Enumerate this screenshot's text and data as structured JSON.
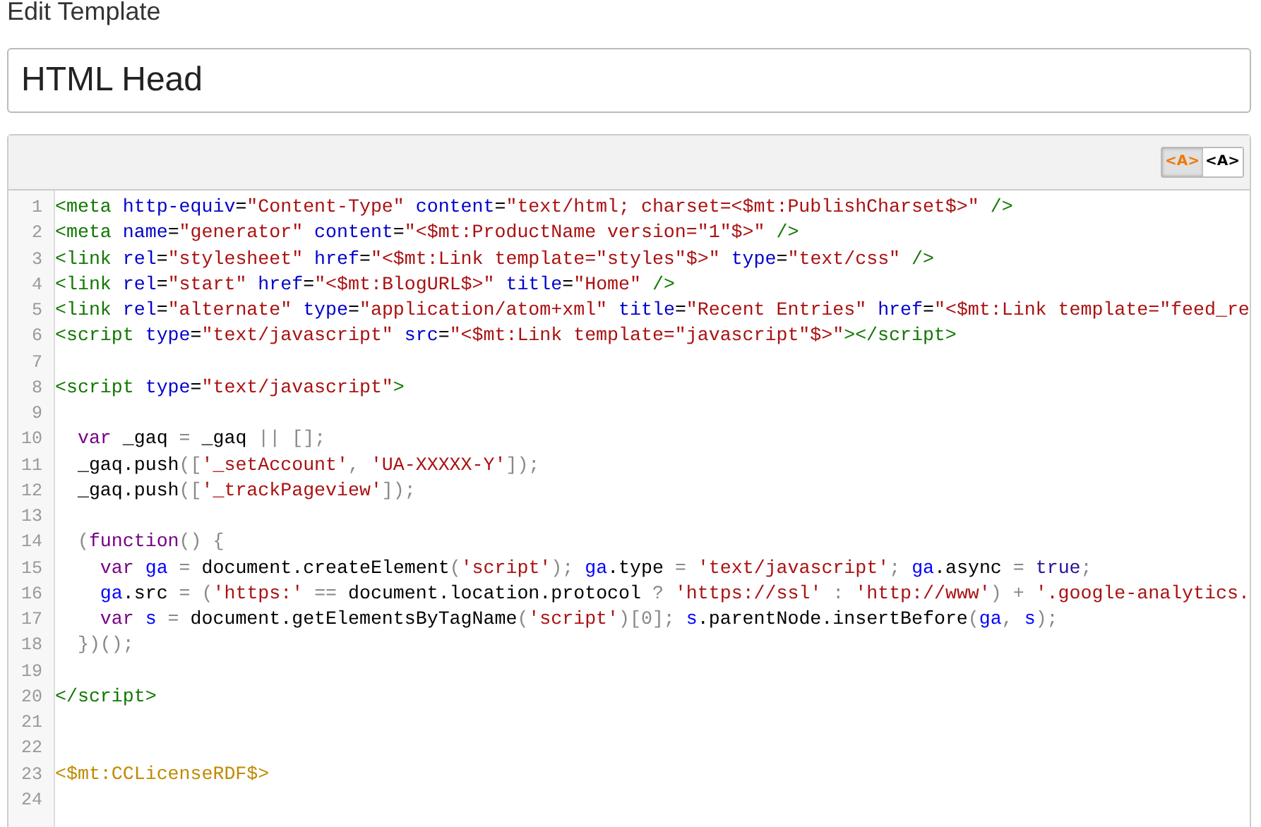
{
  "heading": "Edit Template",
  "template_name": {
    "value": "HTML Head"
  },
  "editor": {
    "toolbar": [
      {
        "label": "<A>",
        "selected": true
      },
      {
        "label": "<A>",
        "selected": false
      }
    ],
    "lines": [
      {
        "number": "1",
        "tokens": [
          {
            "kind": "tag",
            "text": "<meta"
          },
          {
            "kind": "attr",
            "text": " http-equiv"
          },
          {
            "kind": "plain",
            "text": "="
          },
          {
            "kind": "str",
            "text": "\"Content-Type\""
          },
          {
            "kind": "attr",
            "text": " content"
          },
          {
            "kind": "plain",
            "text": "="
          },
          {
            "kind": "str",
            "text": "\"text/html; charset=<$mt:PublishCharset$>\""
          },
          {
            "kind": "tag",
            "text": " />"
          }
        ]
      },
      {
        "number": "2",
        "tokens": [
          {
            "kind": "tag",
            "text": "<meta"
          },
          {
            "kind": "attr",
            "text": " name"
          },
          {
            "kind": "plain",
            "text": "="
          },
          {
            "kind": "str",
            "text": "\"generator\""
          },
          {
            "kind": "attr",
            "text": " content"
          },
          {
            "kind": "plain",
            "text": "="
          },
          {
            "kind": "str",
            "text": "\"<$mt:ProductName version=\"1\"$>\""
          },
          {
            "kind": "tag",
            "text": " />"
          }
        ]
      },
      {
        "number": "3",
        "tokens": [
          {
            "kind": "tag",
            "text": "<link"
          },
          {
            "kind": "attr",
            "text": " rel"
          },
          {
            "kind": "plain",
            "text": "="
          },
          {
            "kind": "str",
            "text": "\"stylesheet\""
          },
          {
            "kind": "attr",
            "text": " href"
          },
          {
            "kind": "plain",
            "text": "="
          },
          {
            "kind": "str",
            "text": "\"<$mt:Link template=\"styles\"$>\""
          },
          {
            "kind": "attr",
            "text": " type"
          },
          {
            "kind": "plain",
            "text": "="
          },
          {
            "kind": "str",
            "text": "\"text/css\""
          },
          {
            "kind": "tag",
            "text": " />"
          }
        ]
      },
      {
        "number": "4",
        "tokens": [
          {
            "kind": "tag",
            "text": "<link"
          },
          {
            "kind": "attr",
            "text": " rel"
          },
          {
            "kind": "plain",
            "text": "="
          },
          {
            "kind": "str",
            "text": "\"start\""
          },
          {
            "kind": "attr",
            "text": " href"
          },
          {
            "kind": "plain",
            "text": "="
          },
          {
            "kind": "str",
            "text": "\"<$mt:BlogURL$>\""
          },
          {
            "kind": "attr",
            "text": " title"
          },
          {
            "kind": "plain",
            "text": "="
          },
          {
            "kind": "str",
            "text": "\"Home\""
          },
          {
            "kind": "tag",
            "text": " />"
          }
        ]
      },
      {
        "number": "5",
        "tokens": [
          {
            "kind": "tag",
            "text": "<link"
          },
          {
            "kind": "attr",
            "text": " rel"
          },
          {
            "kind": "plain",
            "text": "="
          },
          {
            "kind": "str",
            "text": "\"alternate\""
          },
          {
            "kind": "attr",
            "text": " type"
          },
          {
            "kind": "plain",
            "text": "="
          },
          {
            "kind": "str",
            "text": "\"application/atom+xml\""
          },
          {
            "kind": "attr",
            "text": " title"
          },
          {
            "kind": "plain",
            "text": "="
          },
          {
            "kind": "str",
            "text": "\"Recent Entries\""
          },
          {
            "kind": "attr",
            "text": " href"
          },
          {
            "kind": "plain",
            "text": "="
          },
          {
            "kind": "str",
            "text": "\"<$mt:Link template=\"feed_re"
          }
        ]
      },
      {
        "number": "6",
        "tokens": [
          {
            "kind": "tag",
            "text": "<script"
          },
          {
            "kind": "attr",
            "text": " type"
          },
          {
            "kind": "plain",
            "text": "="
          },
          {
            "kind": "str",
            "text": "\"text/javascript\""
          },
          {
            "kind": "attr",
            "text": " src"
          },
          {
            "kind": "plain",
            "text": "="
          },
          {
            "kind": "str",
            "text": "\"<$mt:Link template=\"javascript\"$>\""
          },
          {
            "kind": "tag",
            "text": "></script>"
          }
        ]
      },
      {
        "number": "7"
      },
      {
        "number": "8",
        "tokens": [
          {
            "kind": "tag",
            "text": "<script"
          },
          {
            "kind": "attr",
            "text": " type"
          },
          {
            "kind": "plain",
            "text": "="
          },
          {
            "kind": "str",
            "text": "\"text/javascript\""
          },
          {
            "kind": "tag",
            "text": ">"
          }
        ]
      },
      {
        "number": "9"
      },
      {
        "number": "10",
        "tokens": [
          {
            "kind": "kw",
            "text": "  var"
          },
          {
            "kind": "plain",
            "text": " _gaq "
          },
          {
            "kind": "op",
            "text": "="
          },
          {
            "kind": "plain",
            "text": " _gaq "
          },
          {
            "kind": "op",
            "text": "|| [];"
          }
        ]
      },
      {
        "number": "11",
        "tokens": [
          {
            "kind": "plain",
            "text": "  _gaq.push"
          },
          {
            "kind": "op",
            "text": "(["
          },
          {
            "kind": "str",
            "text": "'_setAccount'"
          },
          {
            "kind": "op",
            "text": ", "
          },
          {
            "kind": "str",
            "text": "'UA-XXXXX-Y'"
          },
          {
            "kind": "op",
            "text": "]);"
          }
        ]
      },
      {
        "number": "12",
        "tokens": [
          {
            "kind": "plain",
            "text": "  _gaq.push"
          },
          {
            "kind": "op",
            "text": "(["
          },
          {
            "kind": "str",
            "text": "'_trackPageview'"
          },
          {
            "kind": "op",
            "text": "]);"
          }
        ]
      },
      {
        "number": "13"
      },
      {
        "number": "14",
        "tokens": [
          {
            "kind": "op",
            "text": "  ("
          },
          {
            "kind": "kw",
            "text": "function"
          },
          {
            "kind": "op",
            "text": "() {"
          }
        ]
      },
      {
        "number": "15",
        "tokens": [
          {
            "kind": "kw",
            "text": "    var"
          },
          {
            "kind": "def",
            "text": " ga"
          },
          {
            "kind": "op",
            "text": " = "
          },
          {
            "kind": "plain",
            "text": "document.createElement"
          },
          {
            "kind": "op",
            "text": "("
          },
          {
            "kind": "str",
            "text": "'script'"
          },
          {
            "kind": "op",
            "text": "); "
          },
          {
            "kind": "def",
            "text": "ga"
          },
          {
            "kind": "plain",
            "text": ".type "
          },
          {
            "kind": "op",
            "text": "= "
          },
          {
            "kind": "str",
            "text": "'text/javascript'"
          },
          {
            "kind": "op",
            "text": "; "
          },
          {
            "kind": "def",
            "text": "ga"
          },
          {
            "kind": "plain",
            "text": ".async "
          },
          {
            "kind": "op",
            "text": "= "
          },
          {
            "kind": "atom",
            "text": "true"
          },
          {
            "kind": "op",
            "text": ";"
          }
        ]
      },
      {
        "number": "16",
        "tokens": [
          {
            "kind": "def",
            "text": "    ga"
          },
          {
            "kind": "plain",
            "text": ".src "
          },
          {
            "kind": "op",
            "text": "= ("
          },
          {
            "kind": "str",
            "text": "'https:'"
          },
          {
            "kind": "op",
            "text": " == "
          },
          {
            "kind": "plain",
            "text": "document.location.protocol "
          },
          {
            "kind": "op",
            "text": "? "
          },
          {
            "kind": "str",
            "text": "'https://ssl'"
          },
          {
            "kind": "op",
            "text": " : "
          },
          {
            "kind": "str",
            "text": "'http://www'"
          },
          {
            "kind": "op",
            "text": ") + "
          },
          {
            "kind": "str",
            "text": "'.google-analytics."
          }
        ]
      },
      {
        "number": "17",
        "tokens": [
          {
            "kind": "kw",
            "text": "    var"
          },
          {
            "kind": "def",
            "text": " s"
          },
          {
            "kind": "op",
            "text": " = "
          },
          {
            "kind": "plain",
            "text": "document.getElementsByTagName"
          },
          {
            "kind": "op",
            "text": "("
          },
          {
            "kind": "str",
            "text": "'script'"
          },
          {
            "kind": "op",
            "text": ")[0]; "
          },
          {
            "kind": "def",
            "text": "s"
          },
          {
            "kind": "plain",
            "text": ".parentNode.insertBefore"
          },
          {
            "kind": "op",
            "text": "("
          },
          {
            "kind": "def",
            "text": "ga"
          },
          {
            "kind": "op",
            "text": ", "
          },
          {
            "kind": "def",
            "text": "s"
          },
          {
            "kind": "op",
            "text": ");"
          }
        ]
      },
      {
        "number": "18",
        "tokens": [
          {
            "kind": "op",
            "text": "  })();"
          }
        ]
      },
      {
        "number": "19"
      },
      {
        "number": "20",
        "tokens": [
          {
            "kind": "tag",
            "text": "</script>"
          }
        ]
      },
      {
        "number": "21"
      },
      {
        "number": "22"
      },
      {
        "number": "23",
        "tokens": [
          {
            "kind": "mt",
            "text": "<$mt:CCLicenseRDF$>"
          }
        ]
      },
      {
        "number": "24"
      }
    ]
  }
}
